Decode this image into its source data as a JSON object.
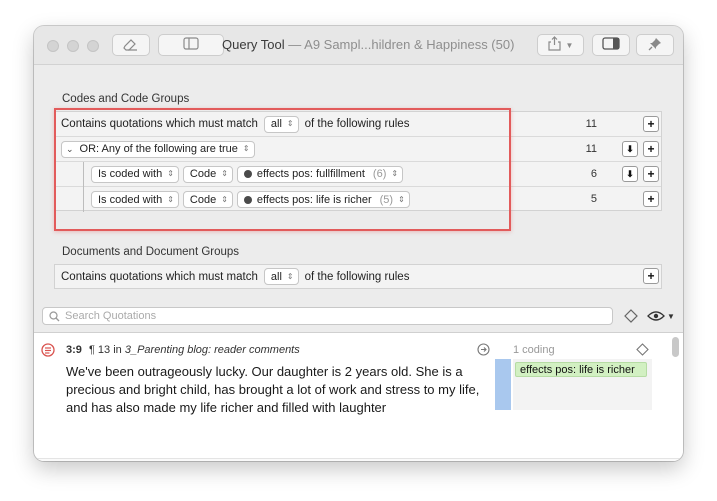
{
  "window": {
    "title_main": "Query Tool",
    "title_sub": " — A9 Sampl...hildren & Happiness (50)"
  },
  "codes_section": {
    "label": "Codes and Code Groups",
    "root_rule": {
      "prefix": "Contains quotations which must match",
      "mode": "all",
      "suffix": "of the following rules",
      "count": "11"
    },
    "or_rule": {
      "label": "OR: Any of the following are true",
      "count": "11"
    },
    "rules": [
      {
        "field": "Is coded with",
        "type": "Code",
        "value": "effects pos: fullfillment",
        "value_count": "(6)",
        "count": "6"
      },
      {
        "field": "Is coded with",
        "type": "Code",
        "value": "effects pos: life is richer",
        "value_count": "(5)",
        "count": "5"
      }
    ]
  },
  "documents_section": {
    "label": "Documents and Document Groups",
    "root_rule": {
      "prefix": "Contains quotations which must match",
      "mode": "all",
      "suffix": "of the following rules"
    }
  },
  "search": {
    "placeholder": "Search Quotations"
  },
  "result": {
    "id": "3:9",
    "para": "¶ 13 in",
    "source": "3_Parenting blog: reader comments",
    "text": "We've been outrageously lucky. Our daughter is 2 years old. She is a precious and bright child, has brought a lot of work and stress to my life, and has also made my life richer and filled with laughter",
    "coding_count": "1 coding",
    "code_tag": "effects pos: life is richer"
  },
  "colors": {
    "highlight": "#e25b5b",
    "code_tag_bg": "#d2f0c2",
    "coding_bar": "#a9c8ee"
  }
}
